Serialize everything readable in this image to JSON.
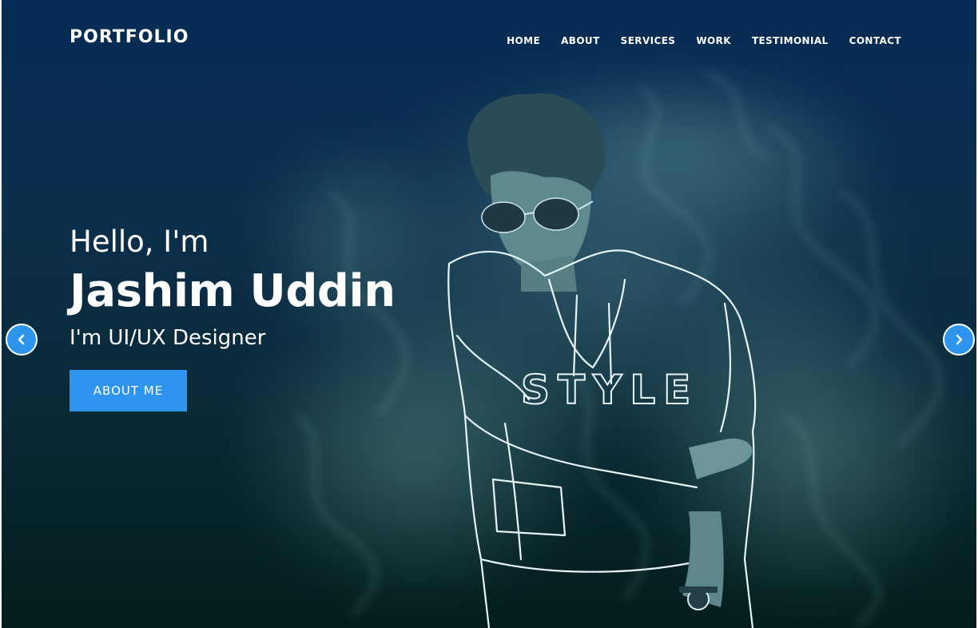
{
  "header": {
    "brand": "PORTFOLIO",
    "menu": [
      {
        "label": "HOME"
      },
      {
        "label": "ABOUT"
      },
      {
        "label": "SERVICES"
      },
      {
        "label": "WORK"
      },
      {
        "label": "TESTIMONIAL"
      },
      {
        "label": "CONTACT"
      }
    ]
  },
  "hero": {
    "greeting": "Hello, I'm",
    "name": "Jashim Uddin",
    "role": "I'm UI/UX Designer",
    "cta_label": "ABOUT ME",
    "shirt_text": "STYLE"
  },
  "slider": {
    "prev_icon": "chevron-left-icon",
    "next_icon": "chevron-right-icon"
  },
  "colors": {
    "accent": "#2e95ee",
    "bg_top": "#062c55",
    "bg_bottom": "#031d1c",
    "text": "#ffffff",
    "smoke": "#8fc7c2"
  }
}
